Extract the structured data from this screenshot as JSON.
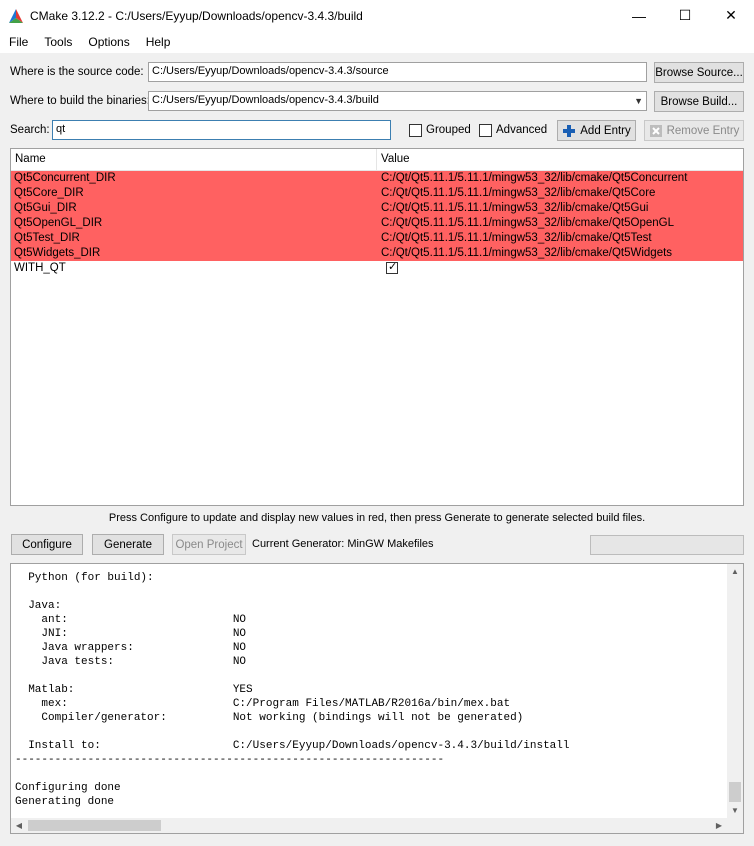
{
  "window": {
    "title": "CMake 3.12.2 - C:/Users/Eyyup/Downloads/opencv-3.4.3/build",
    "minimize": "—",
    "maximize": "☐",
    "close": "✕"
  },
  "menu": [
    "File",
    "Tools",
    "Options",
    "Help"
  ],
  "source": {
    "label": "Where is the source code:",
    "value": "C:/Users/Eyyup/Downloads/opencv-3.4.3/source",
    "browse_label": "Browse Source..."
  },
  "binaries": {
    "label": "Where to build the binaries:",
    "value": "C:/Users/Eyyup/Downloads/opencv-3.4.3/build",
    "browse_label": "Browse Build..."
  },
  "search": {
    "label": "Search:",
    "value": "qt",
    "grouped_label": "Grouped",
    "grouped_checked": false,
    "advanced_label": "Advanced",
    "advanced_checked": false,
    "add_entry_label": "Add Entry",
    "remove_entry_label": "Remove Entry"
  },
  "table": {
    "columns": [
      "Name",
      "Value"
    ],
    "rows": [
      {
        "name": "Qt5Concurrent_DIR",
        "value": "C:/Qt/Qt5.11.1/5.11.1/mingw53_32/lib/cmake/Qt5Concurrent",
        "new": true
      },
      {
        "name": "Qt5Core_DIR",
        "value": "C:/Qt/Qt5.11.1/5.11.1/mingw53_32/lib/cmake/Qt5Core",
        "new": true
      },
      {
        "name": "Qt5Gui_DIR",
        "value": "C:/Qt/Qt5.11.1/5.11.1/mingw53_32/lib/cmake/Qt5Gui",
        "new": true
      },
      {
        "name": "Qt5OpenGL_DIR",
        "value": "C:/Qt/Qt5.11.1/5.11.1/mingw53_32/lib/cmake/Qt5OpenGL",
        "new": true
      },
      {
        "name": "Qt5Test_DIR",
        "value": "C:/Qt/Qt5.11.1/5.11.1/mingw53_32/lib/cmake/Qt5Test",
        "new": true
      },
      {
        "name": "Qt5Widgets_DIR",
        "value": "C:/Qt/Qt5.11.1/5.11.1/mingw53_32/lib/cmake/Qt5Widgets",
        "new": true
      }
    ],
    "checkbox_row": {
      "name": "WITH_QT",
      "checked": true
    }
  },
  "hint": "Press Configure to update and display new values in red, then press Generate to generate selected build files.",
  "actions": {
    "configure": "Configure",
    "generate": "Generate",
    "open_project": "Open Project",
    "generator_label": "Current Generator: MinGW Makefiles"
  },
  "output": "  Python (for build):\n\n  Java:\n    ant:                         NO\n    JNI:                         NO\n    Java wrappers:               NO\n    Java tests:                  NO\n\n  Matlab:                        YES\n    mex:                         C:/Program Files/MATLAB/R2016a/bin/mex.bat\n    Compiler/generator:          Not working (bindings will not be generated)\n\n  Install to:                    C:/Users/Eyyup/Downloads/opencv-3.4.3/build/install\n-----------------------------------------------------------------\n\nConfiguring done\nGenerating done",
  "colors": {
    "new_entry_bg": "#ff6161",
    "add_icon": "#1a5fb4"
  }
}
